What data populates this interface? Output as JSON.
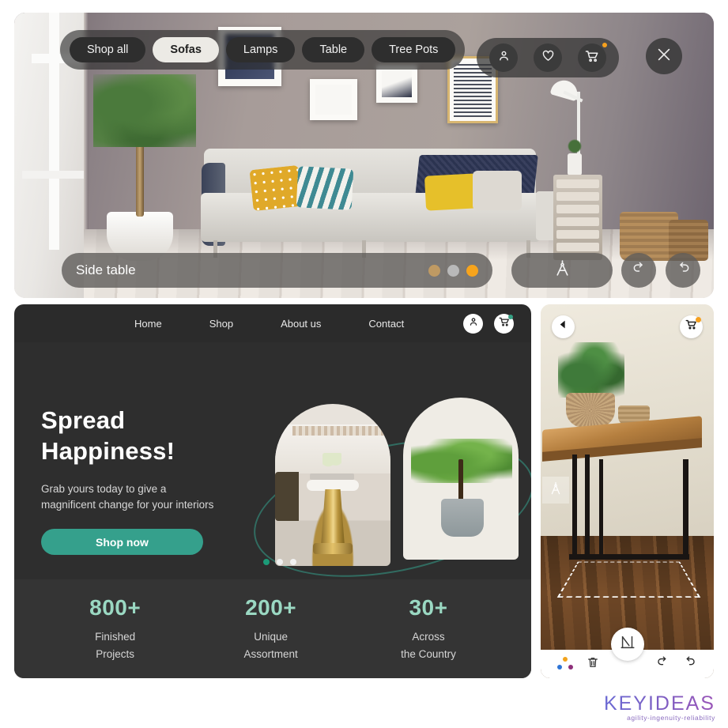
{
  "ar_view": {
    "category_chips": [
      {
        "label": "Shop all",
        "active": false
      },
      {
        "label": "Sofas",
        "active": true
      },
      {
        "label": "Lamps",
        "active": false
      },
      {
        "label": "Table",
        "active": false
      },
      {
        "label": "Tree Pots",
        "active": false
      }
    ],
    "header_icons": [
      "account-icon",
      "wishlist-heart-icon",
      "cart-icon"
    ],
    "close_label": "✕",
    "product_name": "Side table",
    "swatches": [
      {
        "name": "bronze",
        "color": "#bf9a63"
      },
      {
        "name": "grey",
        "color": "#b9b9b9"
      },
      {
        "name": "orange",
        "color": "#f7a41c"
      }
    ],
    "measure_icon": "compass-divider-icon",
    "redo_icon": "redo-icon",
    "undo_icon": "undo-icon"
  },
  "website": {
    "nav_links": [
      "Home",
      "Shop",
      "About us",
      "Contact"
    ],
    "nav_icons": [
      "account-icon",
      "cart-icon"
    ],
    "hero": {
      "title_line1": "Spread",
      "title_line2": "Happiness!",
      "subtitle_line1": "Grab yours today to give a",
      "subtitle_line2": "magnificent change for your interiors",
      "cta_label": "Shop now",
      "accent_color": "#35a08c",
      "carousel": [
        {
          "active": true
        },
        {
          "active": false
        },
        {
          "active": false
        }
      ]
    },
    "stats": [
      {
        "number": "800+",
        "caption_line1": "Finished",
        "caption_line2": "Projects"
      },
      {
        "number": "200+",
        "caption_line1": "Unique",
        "caption_line2": "Assortment"
      },
      {
        "number": "30+",
        "caption_line1": "Across",
        "caption_line2": "the Country"
      }
    ],
    "stat_number_color": "#9ad8c2"
  },
  "phone_ar": {
    "back_icon": "back-arrow-icon",
    "cart_icon": "cart-icon",
    "ar_placement_icon": "compass-divider-icon",
    "toolbar": {
      "colors_icon": "color-palette-dots-icon",
      "delete_icon": "trash-icon",
      "measure_icon": "measure-ruler-icon",
      "redo_icon": "redo-icon",
      "undo_icon": "undo-icon"
    },
    "palette_dots": [
      {
        "color": "#f2a31c"
      },
      {
        "color": "#2d74d6"
      },
      {
        "color": "#8e2f7a"
      }
    ]
  },
  "branding": {
    "name": "KEYIDEAS",
    "tagline": "agility-ingenuity-reliability",
    "gradient_start": "#6b6ad4",
    "gradient_end": "#9a55b8"
  }
}
